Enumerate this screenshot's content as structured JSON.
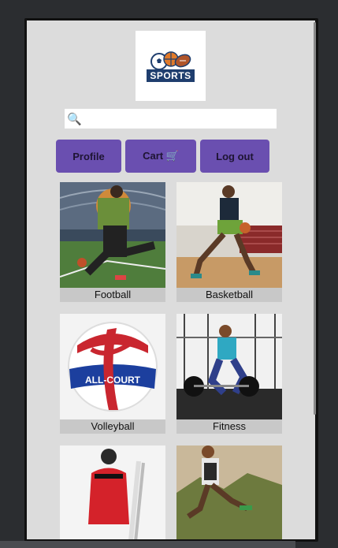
{
  "header": {
    "logo_text": "SPORTS"
  },
  "search": {
    "placeholder": "",
    "value": ""
  },
  "nav": {
    "profile_label": "Profile",
    "cart_label": "Cart 🛒",
    "logout_label": "Log out"
  },
  "categories": [
    {
      "label": "Football"
    },
    {
      "label": "Basketball"
    },
    {
      "label": "Volleyball"
    },
    {
      "label": "Fitness"
    },
    {
      "label": ""
    },
    {
      "label": ""
    }
  ],
  "colors": {
    "accent": "#6a4fb0",
    "background": "#dcdcdc",
    "logo_bg": "#1f3e6e"
  }
}
